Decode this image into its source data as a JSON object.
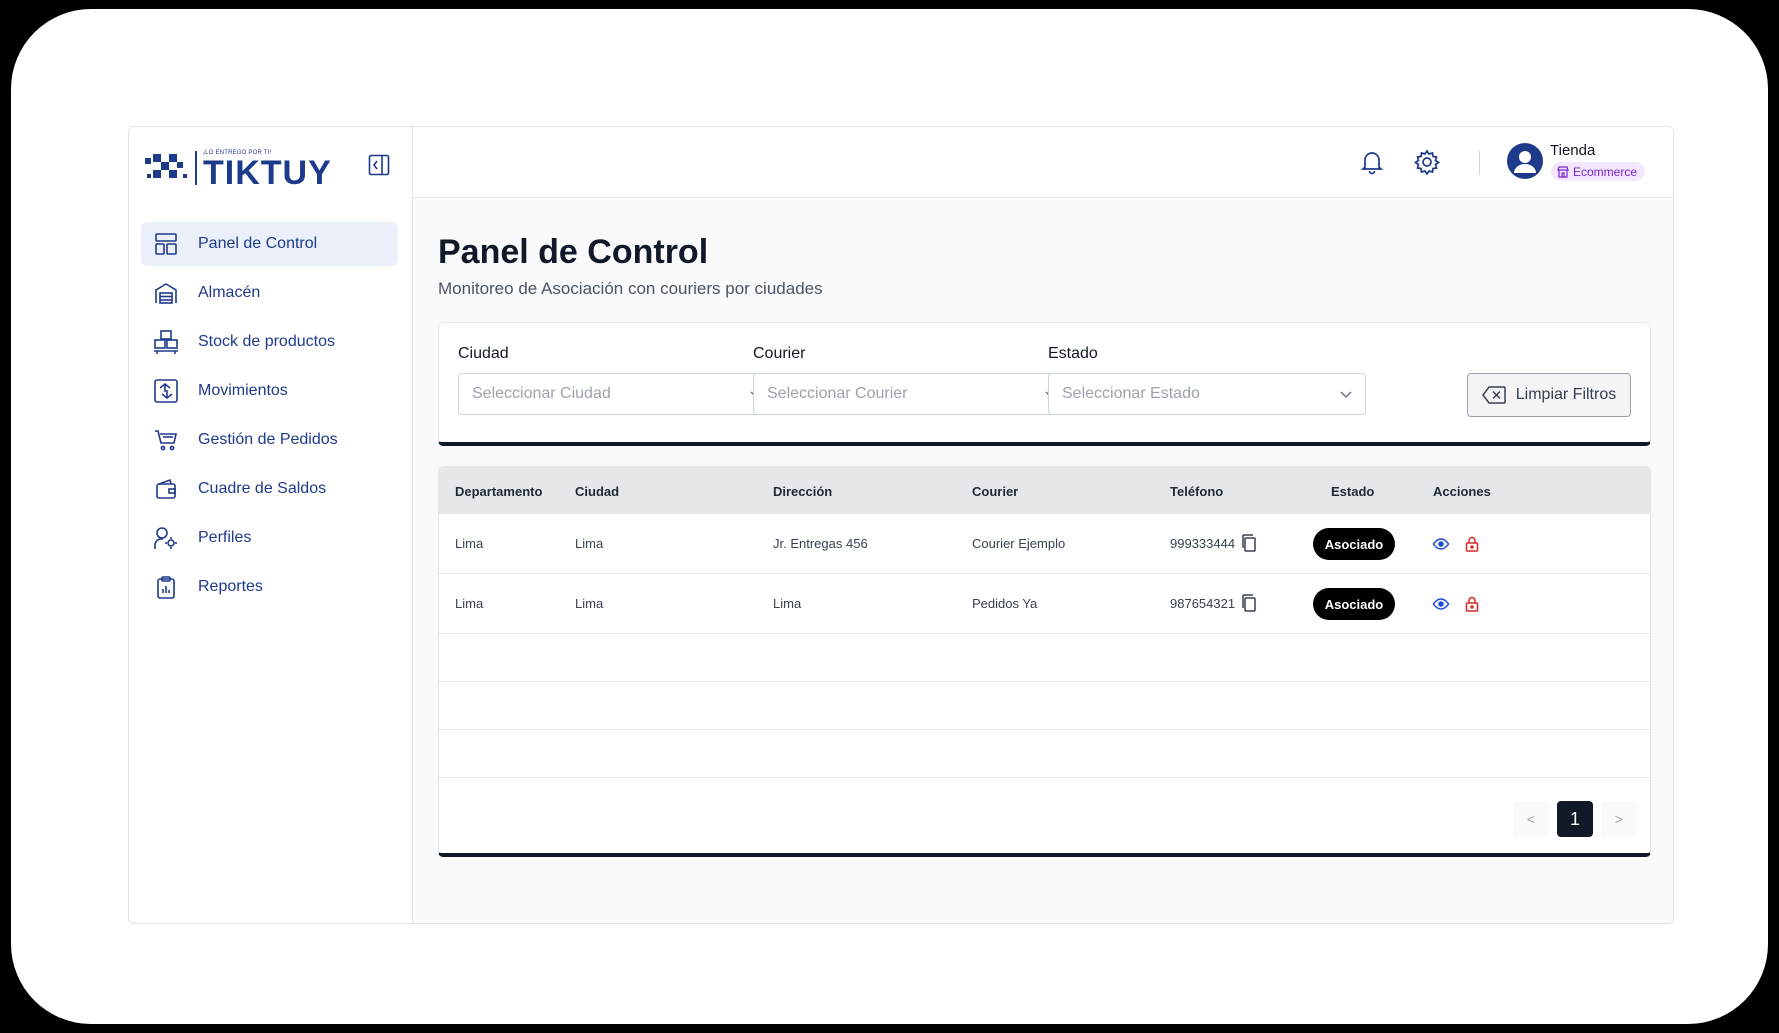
{
  "brand": {
    "name": "TIKTUY",
    "tagline": "¡LO ENTREGO POR TI!"
  },
  "sidebar": {
    "items": [
      {
        "label": "Panel de Control",
        "icon": "dashboard-icon",
        "active": true
      },
      {
        "label": "Almacén",
        "icon": "warehouse-icon",
        "active": false
      },
      {
        "label": "Stock de productos",
        "icon": "boxes-icon",
        "active": false
      },
      {
        "label": "Movimientos",
        "icon": "movements-icon",
        "active": false
      },
      {
        "label": "Gestión de Pedidos",
        "icon": "cart-icon",
        "active": false
      },
      {
        "label": "Cuadre de Saldos",
        "icon": "wallet-icon",
        "active": false
      },
      {
        "label": "Perfiles",
        "icon": "profiles-icon",
        "active": false
      },
      {
        "label": "Reportes",
        "icon": "clipboard-icon",
        "active": false
      }
    ]
  },
  "header": {
    "user_name": "Tienda",
    "user_role": "Ecommerce"
  },
  "page": {
    "title": "Panel de Control",
    "subtitle": "Monitoreo de Asociación con couriers por ciudades"
  },
  "filters": {
    "city": {
      "label": "Ciudad",
      "placeholder": "Seleccionar Ciudad"
    },
    "courier": {
      "label": "Courier",
      "placeholder": "Seleccionar Courier"
    },
    "status": {
      "label": "Estado",
      "placeholder": "Seleccionar Estado"
    },
    "clear_label": "Limpiar Filtros"
  },
  "table": {
    "columns": [
      "Departamento",
      "Ciudad",
      "Dirección",
      "Courier",
      "Teléfono",
      "Estado",
      "Acciones"
    ],
    "rows": [
      {
        "departamento": "Lima",
        "ciudad": "Lima",
        "direccion": "Jr. Entregas 456",
        "courier": "Courier Ejemplo",
        "telefono": "999333444",
        "estado": "Asociado"
      },
      {
        "departamento": "Lima",
        "ciudad": "Lima",
        "direccion": "Lima",
        "courier": "Pedidos Ya",
        "telefono": "987654321",
        "estado": "Asociado"
      }
    ]
  },
  "pagination": {
    "prev": "<",
    "current": "1",
    "next": ">"
  },
  "colors": {
    "brand": "#1e3a8a",
    "active_bg": "#eaeff9",
    "badge_bg": "#f3e8ff",
    "badge_text": "#7e22ce",
    "danger": "#dc2626"
  }
}
